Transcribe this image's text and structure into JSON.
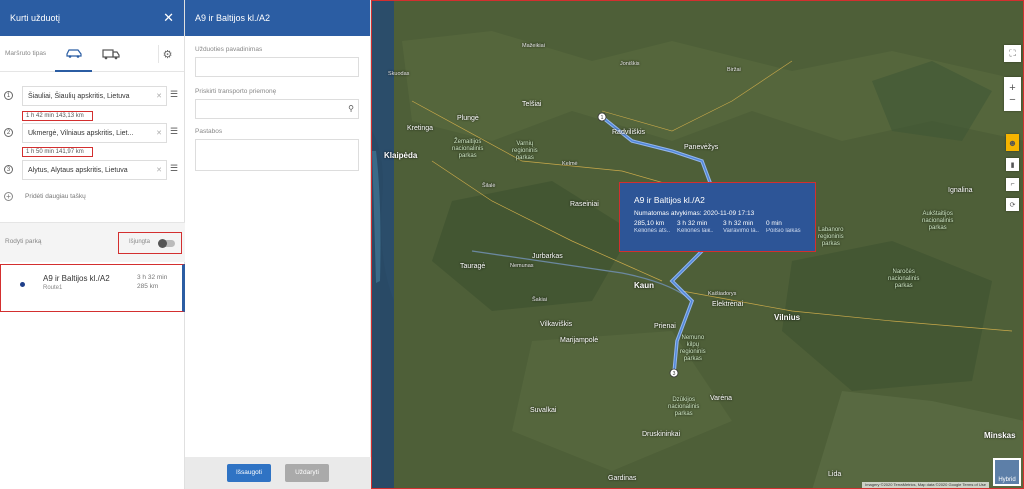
{
  "left_panel": {
    "title": "Kurti užduotį",
    "close_icon": "close-icon",
    "route_type_label": "Maršruto tipas",
    "waypoints": [
      {
        "number": "1",
        "address": "Šiauliai, Šiaulių apskritis, Lietuva"
      },
      {
        "number": "2",
        "address": "Ukmergė, Vilniaus apskritis, Liet..."
      },
      {
        "number": "3",
        "address": "Alytus, Alytaus apskritis, Lietuva"
      }
    ],
    "segments": [
      "1 h 42 min 143,13 km",
      "1 h 50 min 141,97 km"
    ],
    "add_more": "Pridėti daugiau taškų",
    "show_parks_label": "Rodyti parką",
    "toggle_state": "Išjungta",
    "route": {
      "name": "A9 ir Baltijos kl./A2",
      "sub": "Route1",
      "duration": "3 h 32 min",
      "distance": "285 km"
    }
  },
  "middle_panel": {
    "title": "A9 ir Baltijos kl./A2",
    "task_name_label": "Užduoties pavadinimas",
    "vehicle_label": "Priskirti transporto priemonę",
    "notes_label": "Pastabos",
    "save_label": "Išsaugoti",
    "close_label": "Uždaryti"
  },
  "map": {
    "popup": {
      "title": "A9 ir Baltijos kl./A2",
      "eta": "Numatomas atvykimas: 2020-11-09 17:13",
      "stats": [
        {
          "value": "285,10 km",
          "label": "Kelionės ats..."
        },
        {
          "value": "3 h 32 min",
          "label": "Kelionės laiк..."
        },
        {
          "value": "3 h 32 min",
          "label": "Vairavimo la..."
        },
        {
          "value": "0 min",
          "label": "Poilsio laikas"
        }
      ]
    },
    "cities": {
      "klaipeda": "Klaipėda",
      "kaunas": "Kaun",
      "vilnius": "Vilnius",
      "minskas": "Minskas",
      "telsiai": "Telšiai",
      "kretinga": "Kretinga",
      "plunge": "Plungė",
      "raseiniai": "Raseiniai",
      "jurbarkas": "Jurbarkas",
      "tauragė": "Tauragė",
      "silale": "Šilalė",
      "marijampole": "Marijampolė",
      "suvalkai": "Suvalkai",
      "druskininkai": "Druskininkai",
      "prienai": "Prienai",
      "elektrenai": "Elektrėnai",
      "panevezys": "Panevėžys",
      "radviliskis": "Radviliškis",
      "birzai": "Biržai",
      "mazeikiai": "Mažeikiai",
      "joniskis": "Joniškis",
      "ignalina": "Ignalina",
      "lida": "Lida",
      "grodno": "Gardinas",
      "kelme": "Kelmė",
      "varena": "Varėna",
      "kaisiadorys": "Kaišiadorys",
      "vilkaviskis": "Vilkaviškis",
      "sakiai": "Šakiai",
      "skuodas": "Skuodas"
    },
    "parks": {
      "zemaitijos": "Žemaitijos\nnacionalinis\nparkas",
      "varnių": "Varnių\nregioninis\nparkas",
      "labanoro": "Labanoro\nregioninis\nparkas",
      "aukstaitijos": "Aukštaitijos\nnacionalinis\nparkas",
      "naroch": "Naročės\nnacionalinis\nparkas",
      "dzukijos": "Dzūkijos\nnacionalinis\nparkas",
      "nemuno": "Nemuno\nkilpų\nregioninis\nparkas"
    },
    "river_label": "Nemunas",
    "hybrid_label": "Hybrid",
    "attribution": "Imagery ©2020 TerraMetrics, Map data ©2020 Google  Terms of Use"
  }
}
